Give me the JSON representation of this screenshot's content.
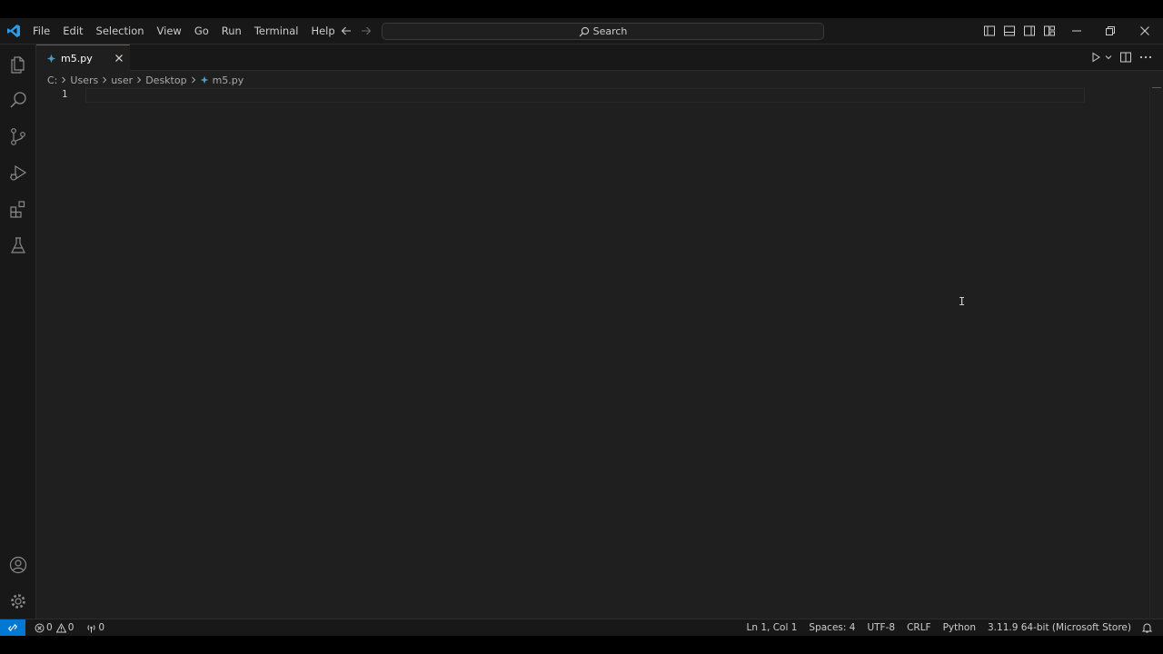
{
  "menu": [
    "File",
    "Edit",
    "Selection",
    "View",
    "Go",
    "Run",
    "Terminal",
    "Help"
  ],
  "search": {
    "label": "Search"
  },
  "tab": {
    "label": "m5.py"
  },
  "breadcrumb": [
    "C:",
    "Users",
    "user",
    "Desktop",
    "m5.py"
  ],
  "editor": {
    "line_number": "1",
    "cursor_glyph": "I"
  },
  "status": {
    "errors": "0",
    "warnings": "0",
    "ports": "0",
    "position": "Ln 1, Col 1",
    "spaces": "Spaces: 4",
    "encoding": "UTF-8",
    "eol": "CRLF",
    "language": "Python",
    "interpreter": "3.11.9 64-bit (Microsoft Store)"
  },
  "colors": {
    "accent": "#0078d4",
    "editor_bg": "#1f1f1f",
    "chrome_bg": "#181818",
    "python_icon": "#519aba"
  }
}
